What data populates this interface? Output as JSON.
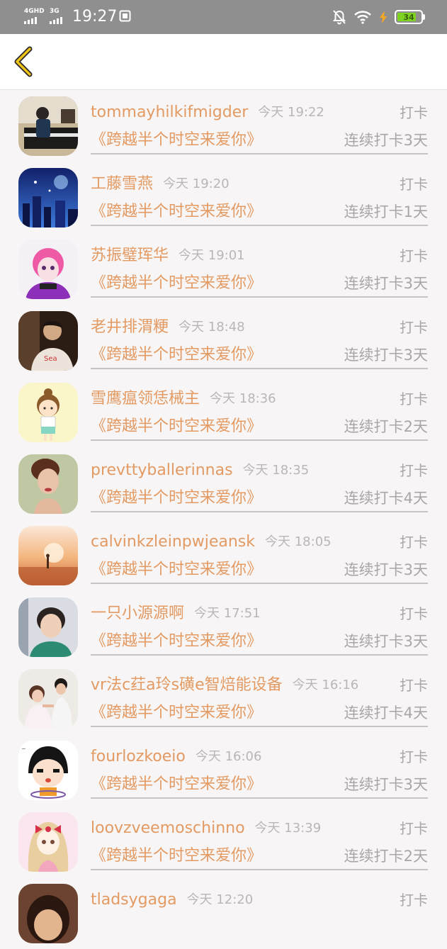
{
  "status_bar": {
    "network_1": "4GHD",
    "network_2": "3G",
    "time": "19:27",
    "battery": "34",
    "battery_color": "#7ed321",
    "icons": [
      "screenshot-icon",
      "mute-bell-icon",
      "wifi-icon",
      "charging-bolt-icon",
      "battery-icon"
    ]
  },
  "nav": {
    "back_icon": "chevron-left-icon",
    "accent_color": "#f0c419"
  },
  "colors": {
    "name_orange": "#e39a63",
    "meta_gray": "#aaa6a6",
    "background": "#f7f5f5"
  },
  "entries": [
    {
      "name": "tommayhilkifmigder",
      "time": "今天 19:22",
      "action": "打卡",
      "book": "《跨越半个时空来爱你》",
      "streak": "连续打卡3天",
      "avatar": "photo-avatar-piano"
    },
    {
      "name": "工藤雪燕",
      "time": "今天 19:20",
      "action": "打卡",
      "book": "《跨越半个时空来爱你》",
      "streak": "连续打卡1天",
      "avatar": "photo-avatar-city-night"
    },
    {
      "name": "苏振璧珲华",
      "time": "今天 19:01",
      "action": "打卡",
      "book": "《跨越半个时空来爱你》",
      "streak": "连续打卡3天",
      "avatar": "anime-avatar-pink-hair"
    },
    {
      "name": "老井排渭粳",
      "time": "今天 18:48",
      "action": "打卡",
      "book": "《跨越半个时空来爱你》",
      "streak": "连续打卡3天",
      "avatar": "photo-avatar-man"
    },
    {
      "name": "雪鹰瘟领恁械主",
      "time": "今天 18:36",
      "action": "打卡",
      "book": "《跨越半个时空来爱你》",
      "streak": "连续打卡2天",
      "avatar": "cartoon-avatar-girl"
    },
    {
      "name": "prevttyballerinnas",
      "time": "今天 18:35",
      "action": "打卡",
      "book": "《跨越半个时空来爱你》",
      "streak": "连续打卡4天",
      "avatar": "photo-avatar-woman"
    },
    {
      "name": "calvinkzleinpwjeansk",
      "time": "今天 18:05",
      "action": "打卡",
      "book": "《跨越半个时空来爱你》",
      "streak": "连续打卡3天",
      "avatar": "photo-avatar-sunset"
    },
    {
      "name": "一只小源源啊",
      "time": "今天 17:51",
      "action": "打卡",
      "book": "《跨越半个时空来爱你》",
      "streak": "连续打卡3天",
      "avatar": "photo-avatar-boy"
    },
    {
      "name": "vr法c荭a玲s磺e智焙能设备",
      "time": "今天 16:16",
      "action": "打卡",
      "book": "《跨越半个时空来爱你》",
      "streak": "连续打卡4天",
      "avatar": "photo-avatar-couple"
    },
    {
      "name": "fourlozkoeio",
      "time": "今天 16:06",
      "action": "打卡",
      "book": "《跨越半个时空来爱你》",
      "streak": "连续打卡3天",
      "avatar": "cartoon-avatar-black-hair"
    },
    {
      "name": "loovzveemoschinno",
      "time": "今天 13:39",
      "action": "打卡",
      "book": "《跨越半个时空来爱你》",
      "streak": "连续打卡2天",
      "avatar": "anime-avatar-bow-girl"
    },
    {
      "name": "tladsygaga",
      "time": "今天 12:20",
      "action": "打卡",
      "book": "",
      "streak": "",
      "avatar": "photo-avatar-partial"
    }
  ]
}
